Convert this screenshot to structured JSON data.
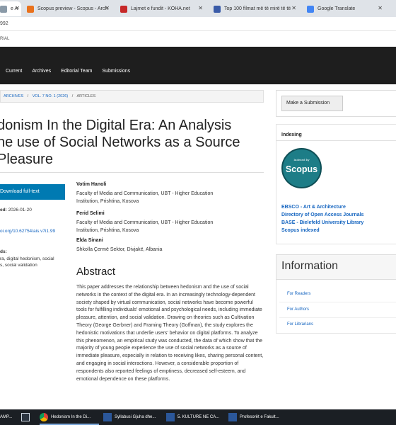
{
  "browser": {
    "tabs": [
      {
        "title": "e A",
        "icon": "ojs-icon",
        "active": true
      },
      {
        "title": "Scopus preview - Scopus - Arch",
        "icon": "scopus-icon"
      },
      {
        "title": "Lajmet e fundit - KOHA.net",
        "icon": "koha-icon"
      },
      {
        "title": "Top 100 filmat më të mirë të të",
        "icon": "imdb-icon"
      },
      {
        "title": "Google Translate",
        "icon": "translate-icon"
      }
    ],
    "address_fragment": "992"
  },
  "site": {
    "label_fragment": "RIAL",
    "nav": [
      "Current",
      "Archives",
      "Editorial Team",
      "Submissions"
    ]
  },
  "breadcrumb": {
    "archives": "ARCHIVES",
    "sep1": "/",
    "issue": "VOL. 7 NO. 1 (2026)",
    "sep2": "/",
    "articles": "ARTICLES"
  },
  "article": {
    "title_lines": [
      "donism In the Digital Era: An Analysis",
      "he use of Social Networks as a Source",
      "Pleasure"
    ],
    "download_label": "Download full-text",
    "published_label": "ed:",
    "published_date": "2026-01-20",
    "doi": "oi.org/10.62754/ais.v7i1.99",
    "keywords_label": "ds:",
    "keywords_line1": "ra, digital hedonism, social",
    "keywords_line2": "s, social validation",
    "authors": [
      {
        "name": "Votim Hanoli",
        "aff1": "Faculty of Media and Communication, UBT - Higher Education",
        "aff2": "Institution, Prishtina, Kosova"
      },
      {
        "name": "Ferid Selimi",
        "aff1": "Faculty of Media and Communication, UBT - Higher Education",
        "aff2": "Institution, Prishtina, Kosova"
      },
      {
        "name": "Elda Sinani",
        "aff1": "Shkolla Çermë Sektor, Divjakë, Albania",
        "aff2": ""
      }
    ],
    "abstract_heading": "Abstract",
    "abstract_text": "This paper addresses the relationship between hedonism and the use of social networks in the context of the digital era. In an increasingly technology-dependent society shaped by virtual communication, social networks have become powerful tools for fulfilling individuals' emotional and psychological needs, including immediate pleasure, attention, and social validation. Drawing on theories such as Cultivation Theory (George Gerbner) and Framing Theory (Goffman), the study explores the hedonistic motivations that underlie users' behavior on digital platforms. To analyze this phenomenon, an empirical study was conducted, the data of which show that the majority of young people experience the use of social networks as a source of immediate pleasure, especially in relation to receiving likes, sharing personal content, and engaging in social interactions. However, a considerable proportion of respondents also reported feelings of emptiness, decreased self-esteem, and emotional dependence on these platforms."
  },
  "sidebar": {
    "submit_label": "Make a Submission",
    "indexing_title": "Indexing",
    "scopus_small": "Indexed by",
    "scopus_big": "Scopus",
    "index_links": [
      "EBSCO - Art & Architecture",
      "Directory of Open Access Journals",
      "BASE - Bielefeld University Library",
      "Scopus indexed"
    ],
    "information_title": "Information",
    "info_links": [
      "For Readers",
      "For Authors",
      "For Librarians"
    ]
  },
  "taskbar": {
    "items": [
      {
        "label": "AMP...",
        "icon": "app-icon"
      },
      {
        "label": "",
        "icon": "calendar-icon"
      },
      {
        "label": "Hedonism In the Di...",
        "icon": "chrome-icon"
      },
      {
        "label": "Syllabusi Gjuha dhe...",
        "icon": "word-icon"
      },
      {
        "label": "5. KULTURE NE CA...",
        "icon": "word-icon"
      },
      {
        "label": "Profesorët e Fakult...",
        "icon": "word-icon"
      }
    ]
  },
  "colors": {
    "nav_bg": "#1e1e1e",
    "accent": "#007ab2",
    "link": "#1565c0",
    "scopus": "#1d7d87"
  }
}
